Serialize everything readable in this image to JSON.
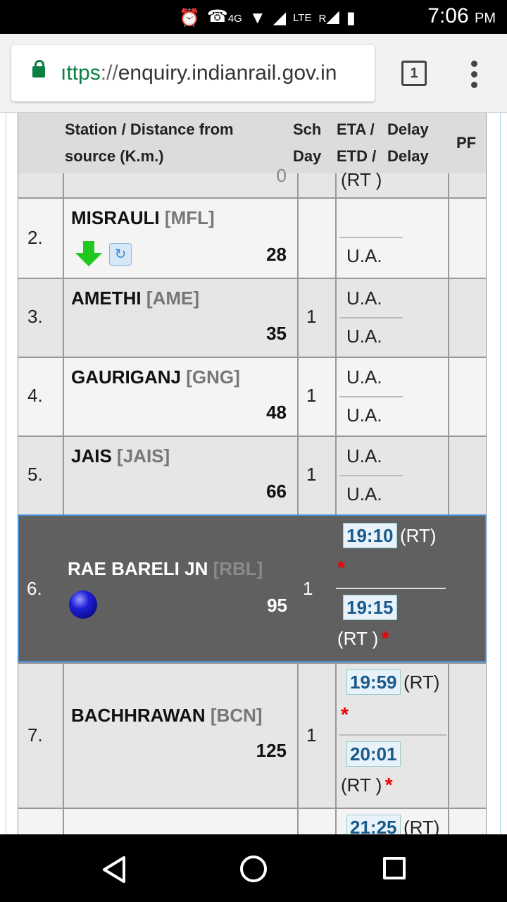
{
  "status_bar": {
    "time": "7:06",
    "ampm": "PM",
    "network_4g": "4G",
    "network_lte": "LTE",
    "roaming": "R",
    "icons": [
      "alarm-icon",
      "volte-call-icon",
      "wifi-icon",
      "signal-icon",
      "battery-charging-icon"
    ]
  },
  "browser": {
    "url_scheme": "https",
    "url_scheme_visible": "ıttps",
    "url_separator": "://",
    "url_host": "enquiry.indianrail.gov.in",
    "tab_count": "1",
    "icons": [
      "lock-icon",
      "tabs-icon",
      "overflow-menu-icon"
    ]
  },
  "table": {
    "headers": {
      "station": "Station / Distance from",
      "station_line2": "source (K.m.)",
      "sch": "Sch",
      "day": "Day",
      "eta": "ETA /",
      "etd": "ETD /",
      "delay": "Delay",
      "delay2": "Delay",
      "pf": "PF"
    },
    "partial_top": {
      "distance": "0",
      "rt": "(RT )"
    },
    "rows": [
      {
        "num": "2.",
        "name": "MISRAULI",
        "code": "[MFL]",
        "distance": "28",
        "day": "",
        "eta": "",
        "etd": "U.A."
      },
      {
        "num": "3.",
        "name": "AMETHI",
        "code": "[AME]",
        "distance": "35",
        "day": "1",
        "eta": "U.A.",
        "etd": "U.A."
      },
      {
        "num": "4.",
        "name": "GAURIGANJ",
        "code": "[GNG]",
        "distance": "48",
        "day": "1",
        "eta": "U.A.",
        "etd": "U.A."
      },
      {
        "num": "5.",
        "name": "JAIS",
        "code": "[JAIS]",
        "distance": "66",
        "day": "1",
        "eta": "U.A.",
        "etd": "U.A."
      },
      {
        "num": "6.",
        "name": "RAE BARELI JN",
        "code": "[RBL]",
        "distance": "95",
        "day": "1",
        "eta_time": "19:10",
        "eta_rt": "(RT)",
        "etd_time": "19:15",
        "etd_rt": "(RT )"
      },
      {
        "num": "7.",
        "name": "BACHHRAWAN",
        "code": "[BCN]",
        "distance": "125",
        "day": "1",
        "eta_time": "19:59",
        "eta_rt": "(RT)",
        "etd_time": "20:01",
        "etd_rt": "(RT )"
      }
    ],
    "partial_bottom": {
      "eta_time": "21:25",
      "eta_rt": "(RT)"
    },
    "star": "*"
  }
}
